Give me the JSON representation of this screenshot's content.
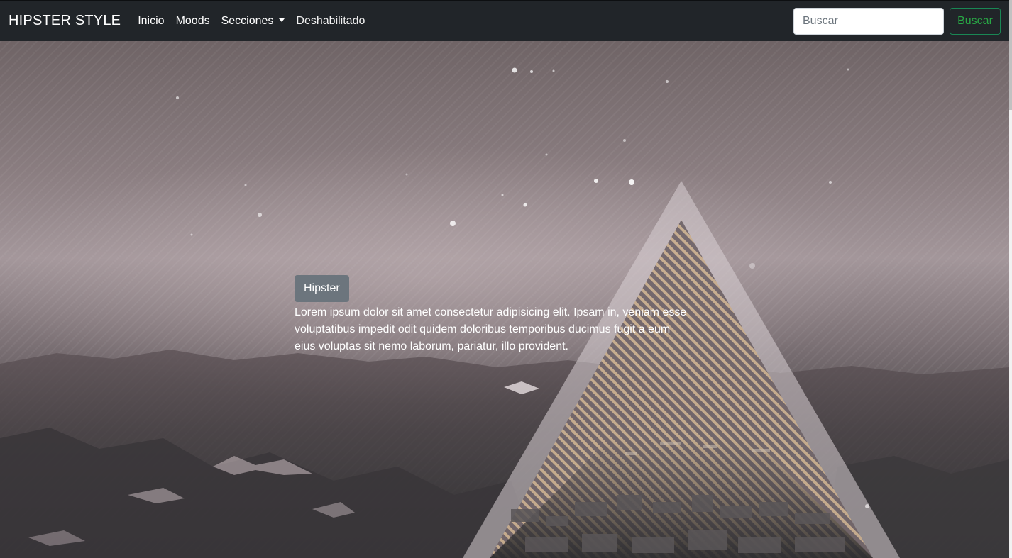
{
  "navbar": {
    "brand": "HIPSTER STYLE",
    "links": [
      {
        "label": "Inicio"
      },
      {
        "label": "Moods"
      },
      {
        "label": "Secciones",
        "dropdown": true
      },
      {
        "label": "Deshabilitado",
        "disabled": true
      }
    ],
    "search": {
      "placeholder": "Buscar",
      "value": "",
      "button_label": "Buscar"
    }
  },
  "hero": {
    "button_label": "Hipster",
    "paragraph": "Lorem ipsum dolor sit amet consectetur adipisicing elit. Ipsam in, veniam esse voluptatibus impedit odit quidem doloribus temporibus ducimus fugit a eum eius voluptas sit nemo laborum, pariatur, illo provident."
  },
  "colors": {
    "navbar_bg": "#212529",
    "search_button_accent": "#28a745",
    "hero_button_bg": "#6c757d"
  }
}
